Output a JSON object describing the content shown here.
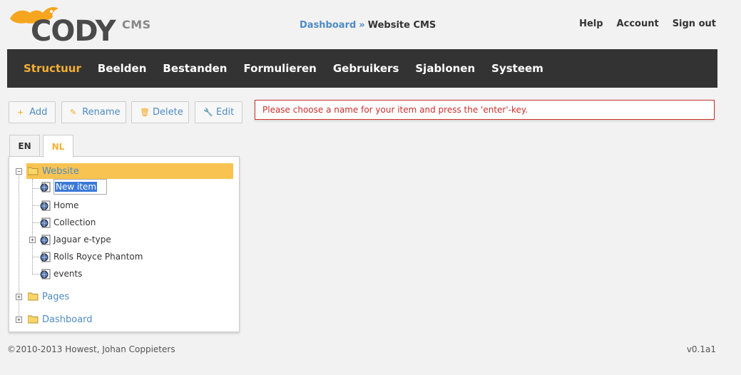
{
  "header": {
    "logo_text": "CODY",
    "logo_suffix": "CMS",
    "breadcrumb": {
      "link": "Dashboard",
      "separator": "»",
      "current": "Website CMS"
    },
    "top_links": [
      "Help",
      "Account",
      "Sign out"
    ]
  },
  "nav": {
    "items": [
      "Structuur",
      "Beelden",
      "Bestanden",
      "Formulieren",
      "Gebruikers",
      "Sjablonen",
      "Systeem"
    ],
    "active_index": 0
  },
  "toolbar": {
    "add": "Add",
    "rename": "Rename",
    "delete": "Delete",
    "edit": "Edit"
  },
  "message": "Please choose a name for your item and press the 'enter'-key.",
  "tabs": [
    "EN",
    "NL"
  ],
  "active_tab": "NL",
  "tree": {
    "root": "Website",
    "editing_value": "New item",
    "children": [
      "Home",
      "Collection",
      "Jaguar e-type",
      "Rolls Royce Phantom",
      "events"
    ],
    "other_roots": [
      "Pages",
      "Dashboard"
    ]
  },
  "footer": {
    "copyright": "©2010-2013 Howest, Johan Coppieters",
    "version": "v0.1a1"
  },
  "colors": {
    "accent": "#f6b032",
    "link": "#4f8bc4",
    "navbar": "#333333",
    "error": "#c9302c",
    "selection": "#f8c351"
  }
}
